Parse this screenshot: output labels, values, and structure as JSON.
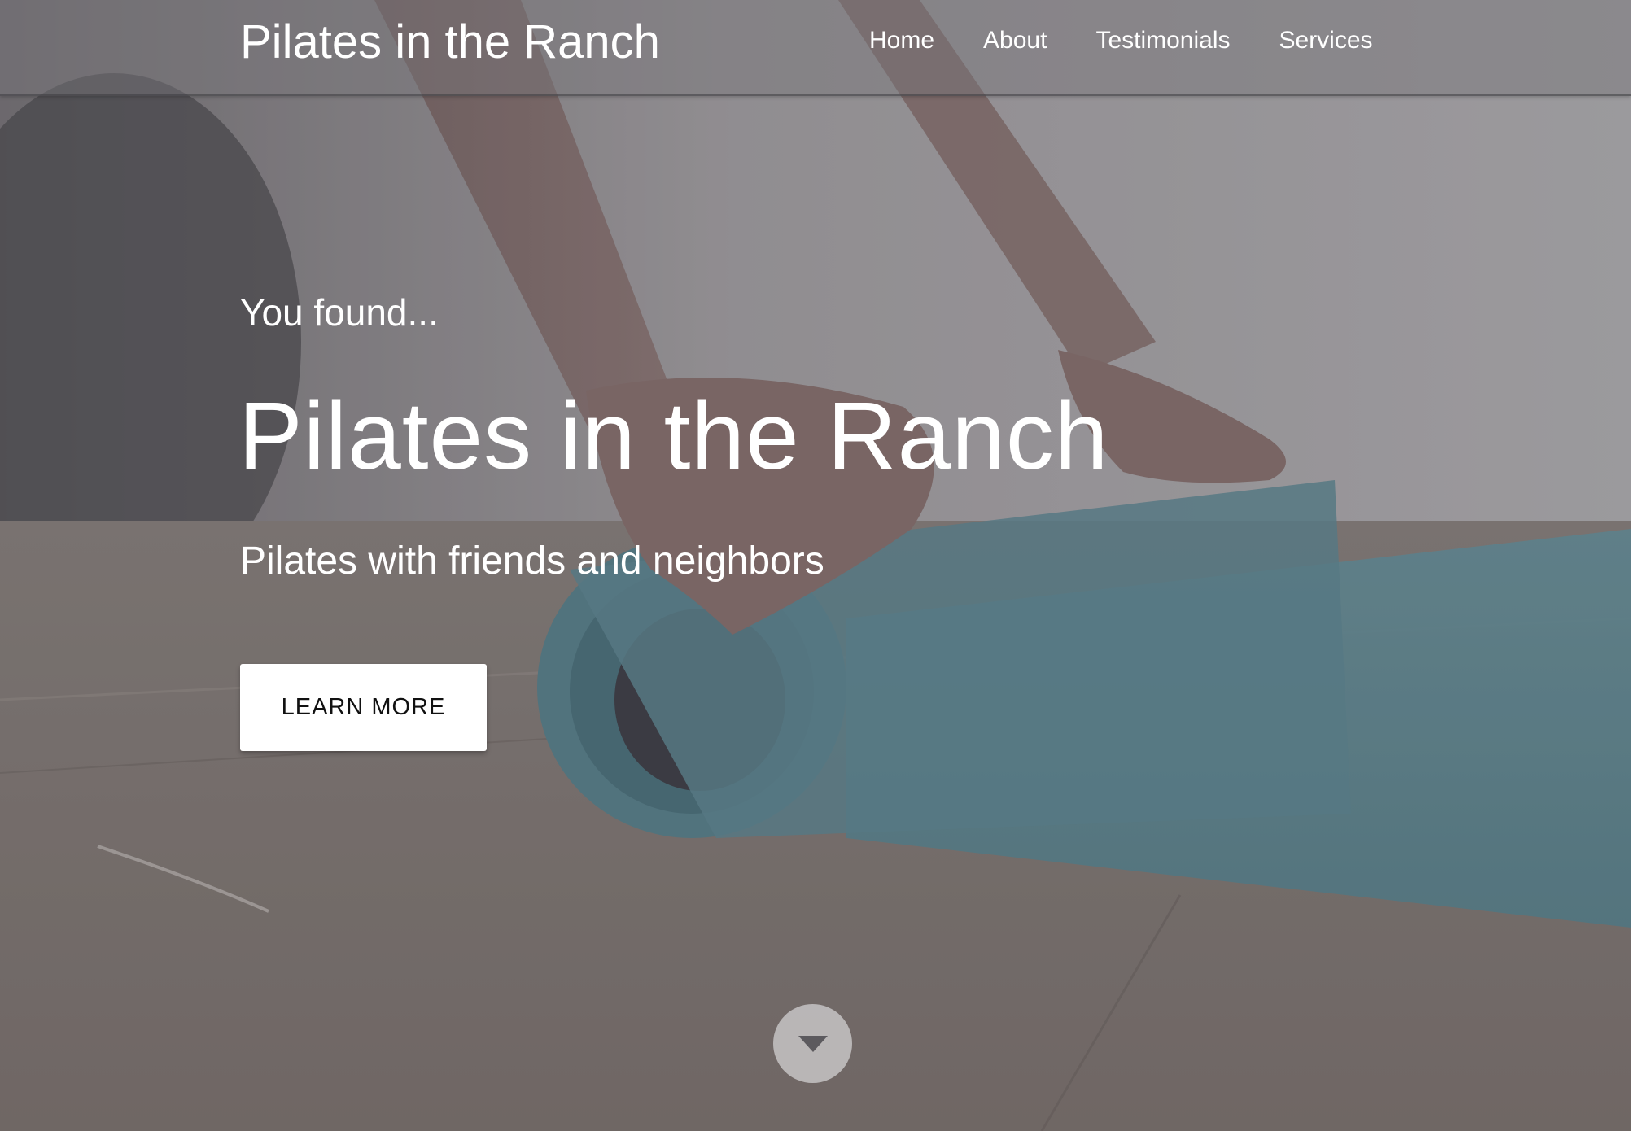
{
  "navbar": {
    "brand": "Pilates in the Ranch",
    "links": [
      {
        "label": "Home"
      },
      {
        "label": "About"
      },
      {
        "label": "Testimonials"
      },
      {
        "label": "Services"
      }
    ]
  },
  "hero": {
    "eyebrow": "You found...",
    "title": "Pilates in the Ranch",
    "subtitle": "Pilates with friends and neighbors",
    "cta_label": "LEARN MORE"
  },
  "scroll_down": {
    "icon": "caret-down-icon"
  },
  "colors": {
    "text": "#ffffff",
    "button_bg": "#ffffff",
    "button_text": "#111111",
    "mat": "#5f8b97"
  }
}
